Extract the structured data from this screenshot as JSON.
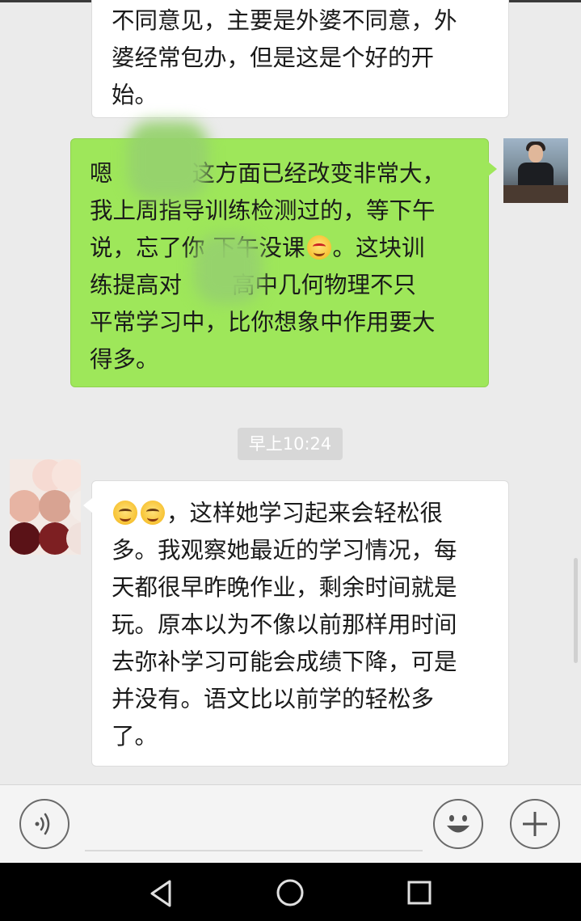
{
  "messages": [
    {
      "side": "left",
      "lines": [
        "不同意见，主要是外婆不同意，外",
        "婆经常包办，但是这是个好的开",
        "始。"
      ]
    },
    {
      "side": "right",
      "lines": [
        "嗯",
        "这方面已经改变非常大，",
        "我上周指导训练检测过的，等下午",
        "说，忘了你",
        "下午没课",
        "。这块训",
        "练提高对",
        "高中几何物理不只",
        "平常学习中，比你想象中作用要大",
        "得多。"
      ]
    },
    {
      "side": "left",
      "lines": [
        "，这样她学习起来会轻松很",
        "多。我观察她最近的学习情况，每",
        "天都很早昨晚作业，剩余时间就是",
        "玩。原本以为不像以前那样用时间",
        "去弥补学习可能会成绩下降，可是",
        "并没有。语文比以前学的轻松多",
        "了。"
      ]
    }
  ],
  "timestamp": "早上10:24",
  "emoji_names": [
    "heart-eyes-emoji",
    "smile-emoji"
  ],
  "icons": {
    "voice": "voice-icon",
    "emoji": "emoji-icon",
    "plus": "plus-icon",
    "back": "back-triangle-icon",
    "home": "home-circle-icon",
    "recents": "recents-square-icon"
  },
  "colors": {
    "sent_bubble": "#9ee75a",
    "received_bubble": "#ffffff",
    "chat_background": "#ebebeb",
    "timestamp_background": "#d7d7d7"
  }
}
